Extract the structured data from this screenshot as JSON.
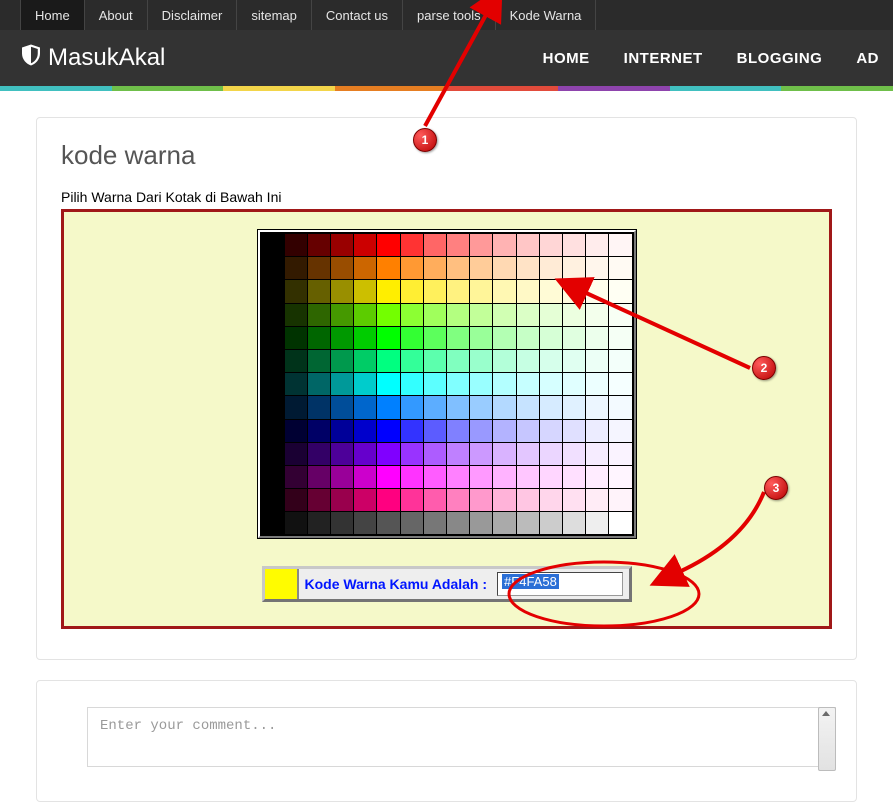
{
  "topnav": [
    "Home",
    "About",
    "Disclaimer",
    "sitemap",
    "Contact us",
    "parse tools",
    "Kode Warna"
  ],
  "brand": "MasukAkal",
  "mainnav": [
    "HOME",
    "INTERNET",
    "BLOGGING",
    "AD"
  ],
  "rainbow": [
    "#41c0c0",
    "#6fbf4a",
    "#f3d54a",
    "#e67e22",
    "#e24b3b",
    "#8e44ad",
    "#41c0c0",
    "#6fbf4a"
  ],
  "page": {
    "title": "kode warna",
    "subtitle": "Pilih Warna Dari Kotak di Bawah Ini",
    "result_label": "Kode Warna Kamu Adalah :",
    "result_value": "#F4FA58",
    "swatch_color": "#fffc00"
  },
  "comment": {
    "placeholder": "Enter your comment..."
  },
  "annotations": {
    "b1": "1",
    "b2": "2",
    "b3": "3"
  },
  "grid_colors": [
    [
      "#000000",
      "#330000",
      "#660000",
      "#990000",
      "#cc0000",
      "#ff0000",
      "#ff3333",
      "#ff6666",
      "#ff8080",
      "#ff9999",
      "#ffb3b3",
      "#ffc6c6",
      "#ffd6d6",
      "#ffe0e0",
      "#ffecec",
      "#fff5f5"
    ],
    [
      "#000000",
      "#331a00",
      "#663300",
      "#994d00",
      "#cc6600",
      "#ff8000",
      "#ff9933",
      "#ffad5c",
      "#ffbf80",
      "#ffcc99",
      "#ffd9b3",
      "#ffe3c6",
      "#ffebd6",
      "#fff1e0",
      "#fff6ec",
      "#fffaf3"
    ],
    [
      "#000000",
      "#333000",
      "#666000",
      "#998f00",
      "#ccbf00",
      "#ffee00",
      "#ffee33",
      "#fff05c",
      "#fff280",
      "#fff599",
      "#fff8b3",
      "#fff9c6",
      "#fffbd6",
      "#fffce0",
      "#fffeec",
      "#fffff3"
    ],
    [
      "#000000",
      "#173300",
      "#2e6600",
      "#459900",
      "#5ccc00",
      "#73ff00",
      "#8cff33",
      "#a0ff5c",
      "#b3ff80",
      "#c2ff99",
      "#d1ffb3",
      "#dbffc6",
      "#e5ffd6",
      "#ecffe0",
      "#f3ffec",
      "#f8fff5"
    ],
    [
      "#000000",
      "#003300",
      "#006600",
      "#009900",
      "#00cc00",
      "#00ff00",
      "#33ff33",
      "#5cff5c",
      "#80ff80",
      "#99ff99",
      "#b3ffb3",
      "#c6ffc6",
      "#d6ffd6",
      "#e0ffe0",
      "#ecffec",
      "#f5fff5"
    ],
    [
      "#000000",
      "#00331a",
      "#006633",
      "#00994d",
      "#00cc66",
      "#00ff80",
      "#33ff99",
      "#5cffad",
      "#80ffbf",
      "#99ffcc",
      "#b3ffd9",
      "#c6ffe3",
      "#d6ffeb",
      "#e0fff1",
      "#ecfff6",
      "#f3fffa"
    ],
    [
      "#000000",
      "#003333",
      "#006666",
      "#009999",
      "#00cccc",
      "#00ffff",
      "#33ffff",
      "#5cffff",
      "#80ffff",
      "#99ffff",
      "#b3ffff",
      "#c6ffff",
      "#d6ffff",
      "#e0ffff",
      "#ecffff",
      "#f5ffff"
    ],
    [
      "#000000",
      "#001a33",
      "#003366",
      "#004d99",
      "#0066cc",
      "#0080ff",
      "#3399ff",
      "#5cadff",
      "#80bfff",
      "#99ccff",
      "#b3d9ff",
      "#c6e3ff",
      "#d6ebff",
      "#e0f1ff",
      "#ecf6ff",
      "#f3faff"
    ],
    [
      "#000000",
      "#000033",
      "#000066",
      "#000099",
      "#0000cc",
      "#0000ff",
      "#3333ff",
      "#5c5cff",
      "#8080ff",
      "#9999ff",
      "#b3b3ff",
      "#c6c6ff",
      "#d6d6ff",
      "#e0e0ff",
      "#ececff",
      "#f5f5ff"
    ],
    [
      "#000000",
      "#1a0033",
      "#330066",
      "#4d0099",
      "#6600cc",
      "#8000ff",
      "#9933ff",
      "#ad5cff",
      "#bf80ff",
      "#cc99ff",
      "#d9b3ff",
      "#e3c6ff",
      "#ebd6ff",
      "#f1e0ff",
      "#f6ecff",
      "#faf3ff"
    ],
    [
      "#000000",
      "#330033",
      "#660066",
      "#990099",
      "#cc00cc",
      "#ff00ff",
      "#ff33ff",
      "#ff5cff",
      "#ff80ff",
      "#ff99ff",
      "#ffb3ff",
      "#ffc6ff",
      "#ffd6ff",
      "#ffe0ff",
      "#ffecff",
      "#fff5ff"
    ],
    [
      "#000000",
      "#33001a",
      "#660033",
      "#99004d",
      "#cc0066",
      "#ff0080",
      "#ff3399",
      "#ff5cad",
      "#ff80bf",
      "#ff99cc",
      "#ffb3d9",
      "#ffc6e3",
      "#ffd6eb",
      "#ffe0f1",
      "#ffecf6",
      "#fff3fa"
    ],
    [
      "#000000",
      "#111111",
      "#222222",
      "#333333",
      "#444444",
      "#555555",
      "#666666",
      "#777777",
      "#888888",
      "#999999",
      "#aaaaaa",
      "#bbbbbb",
      "#cccccc",
      "#dddddd",
      "#eeeeee",
      "#ffffff"
    ]
  ]
}
